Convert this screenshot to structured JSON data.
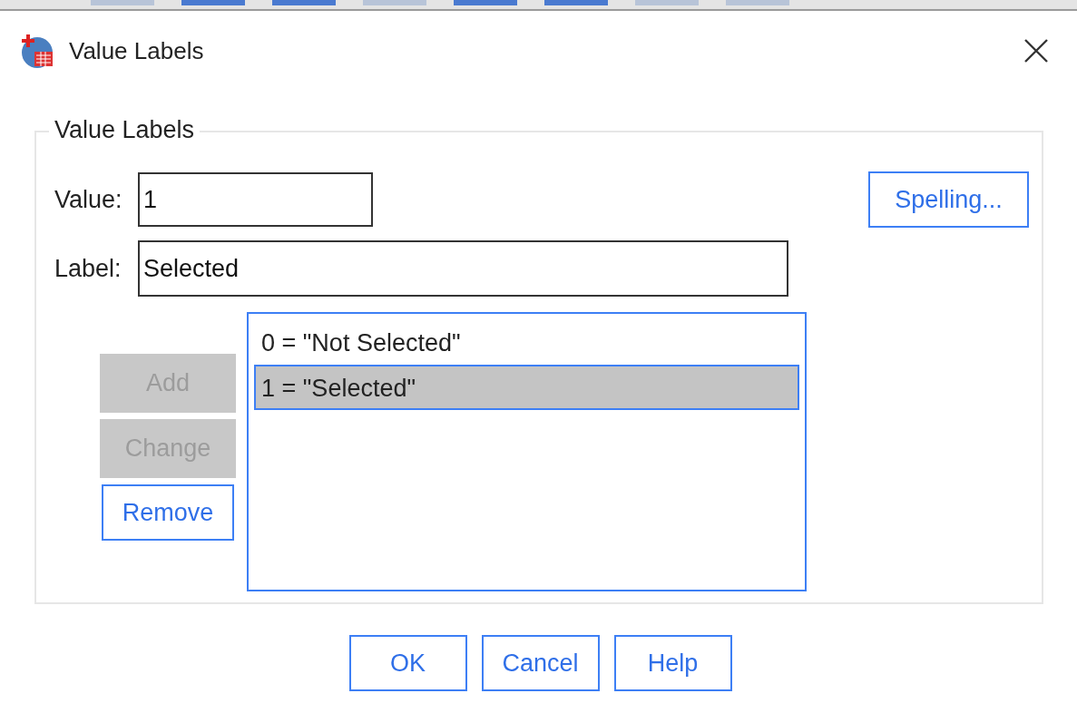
{
  "window": {
    "title": "Value Labels"
  },
  "group": {
    "title": "Value Labels",
    "value": {
      "label": "Value:",
      "value": "1"
    },
    "label": {
      "label": "Label:",
      "value": "Selected"
    },
    "spelling_button": {
      "label": "Spelling...",
      "disabled": false
    },
    "actions": [
      {
        "label": "Add",
        "disabled": true
      },
      {
        "label": "Change",
        "disabled": true
      },
      {
        "label": "Remove",
        "disabled": false
      }
    ],
    "list": [
      {
        "text": "0 = \"Not Selected\"",
        "selected": false
      },
      {
        "text": "1 = \"Selected\"",
        "selected": true
      }
    ]
  },
  "buttons": [
    {
      "label": "OK",
      "disabled": false
    },
    {
      "label": "Cancel",
      "disabled": false
    },
    {
      "label": "Help",
      "disabled": false
    }
  ]
}
